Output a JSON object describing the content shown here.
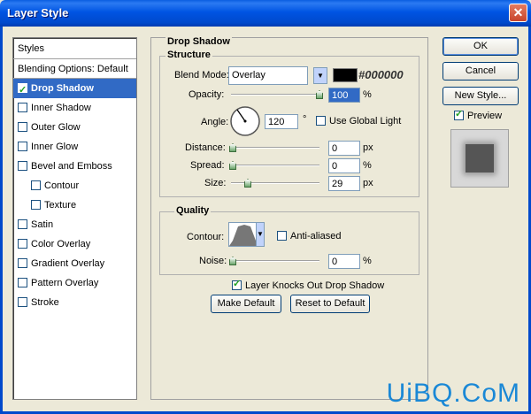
{
  "window": {
    "title": "Layer Style",
    "close_label": "✕"
  },
  "styles_panel": {
    "header": "Styles",
    "blending_options": "Blending Options: Default",
    "items": [
      {
        "label": "Drop Shadow",
        "checked": true,
        "selected": true,
        "sub": false
      },
      {
        "label": "Inner Shadow",
        "checked": false,
        "selected": false,
        "sub": false
      },
      {
        "label": "Outer Glow",
        "checked": false,
        "selected": false,
        "sub": false
      },
      {
        "label": "Inner Glow",
        "checked": false,
        "selected": false,
        "sub": false
      },
      {
        "label": "Bevel and Emboss",
        "checked": false,
        "selected": false,
        "sub": false
      },
      {
        "label": "Contour",
        "checked": false,
        "selected": false,
        "sub": true
      },
      {
        "label": "Texture",
        "checked": false,
        "selected": false,
        "sub": true
      },
      {
        "label": "Satin",
        "checked": false,
        "selected": false,
        "sub": false
      },
      {
        "label": "Color Overlay",
        "checked": false,
        "selected": false,
        "sub": false
      },
      {
        "label": "Gradient Overlay",
        "checked": false,
        "selected": false,
        "sub": false
      },
      {
        "label": "Pattern Overlay",
        "checked": false,
        "selected": false,
        "sub": false
      },
      {
        "label": "Stroke",
        "checked": false,
        "selected": false,
        "sub": false
      }
    ]
  },
  "drop_shadow": {
    "section_title": "Drop Shadow",
    "structure": {
      "title": "Structure",
      "blend_mode_label": "Blend Mode:",
      "blend_mode_value": "Overlay",
      "color_hex": "#000000",
      "opacity_label": "Opacity:",
      "opacity_value": "100",
      "opacity_unit": "%",
      "opacity_level": 1.0,
      "angle_label": "Angle:",
      "angle_value": "120",
      "angle_unit": "°",
      "use_global_light_label": "Use Global Light",
      "use_global_light": false,
      "distance_label": "Distance:",
      "distance_value": "0",
      "distance_unit": "px",
      "spread_label": "Spread:",
      "spread_value": "0",
      "spread_unit": "%",
      "size_label": "Size:",
      "size_value": "29",
      "size_unit": "px"
    },
    "quality": {
      "title": "Quality",
      "contour_label": "Contour:",
      "anti_aliased_label": "Anti-aliased",
      "anti_aliased": false,
      "noise_label": "Noise:",
      "noise_value": "0",
      "noise_unit": "%"
    },
    "knockout_label": "Layer Knocks Out Drop Shadow",
    "knockout_checked": true,
    "make_default_label": "Make Default",
    "reset_default_label": "Reset to Default"
  },
  "right_panel": {
    "ok_label": "OK",
    "cancel_label": "Cancel",
    "new_style_label": "New Style...",
    "preview_label": "Preview",
    "preview_checked": true
  },
  "watermark": "UiBQ.CoM",
  "colors": {
    "title_bar": "#0054e3",
    "selection": "#316ac5",
    "shadow_color": "#000000"
  }
}
